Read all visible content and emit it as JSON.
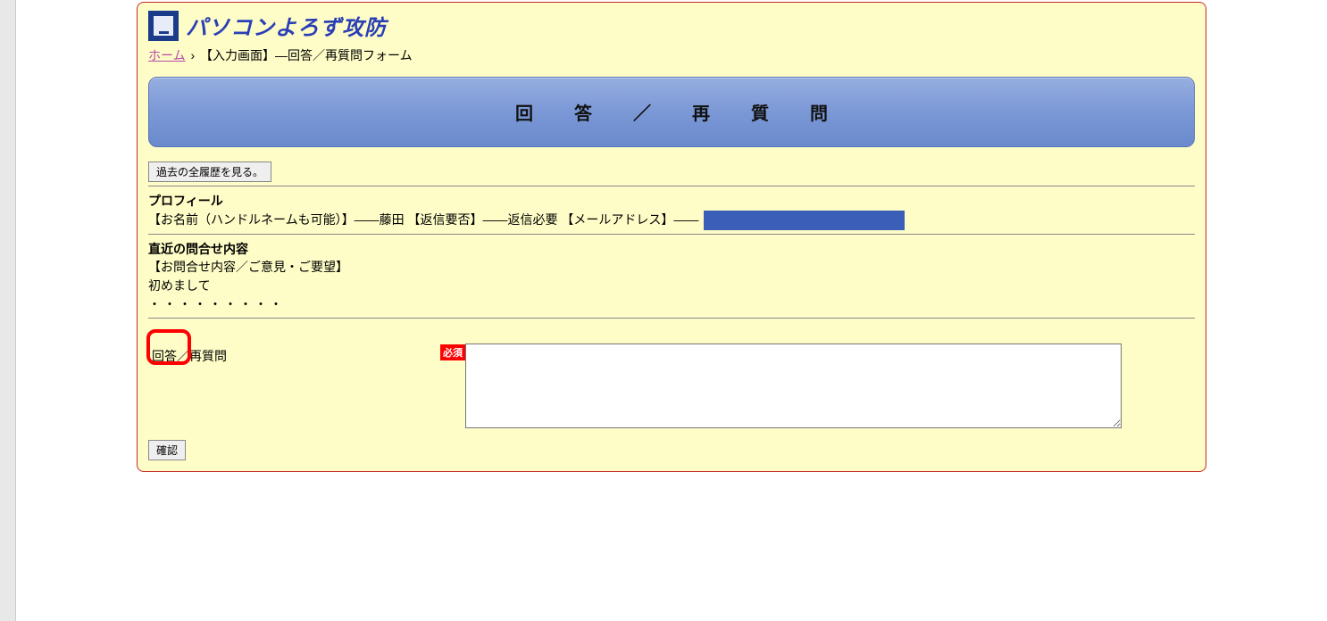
{
  "site": {
    "title": "パソコンよろず攻防"
  },
  "breadcrumb": {
    "home_label": "ホーム",
    "separator": "›",
    "current": "【入力画面】―回答／再質問フォーム"
  },
  "banner": {
    "text": "回答／再質問"
  },
  "buttons": {
    "history": "過去の全履歴を見る。",
    "confirm": "確認"
  },
  "profile": {
    "heading": "プロフィール",
    "line": "【お名前（ハンドルネームも可能）】――藤田 【返信要否】――返信必要 【メールアドレス】――"
  },
  "inquiry": {
    "heading": "直近の問合せ内容",
    "label": "【お問合せ内容／ご意見・ご要望】",
    "body_line1": "初めまして",
    "body_dots": "・・・・・・・・・"
  },
  "form": {
    "answer_label": "回答／再質問",
    "required_badge": "必須",
    "answer_value": ""
  }
}
